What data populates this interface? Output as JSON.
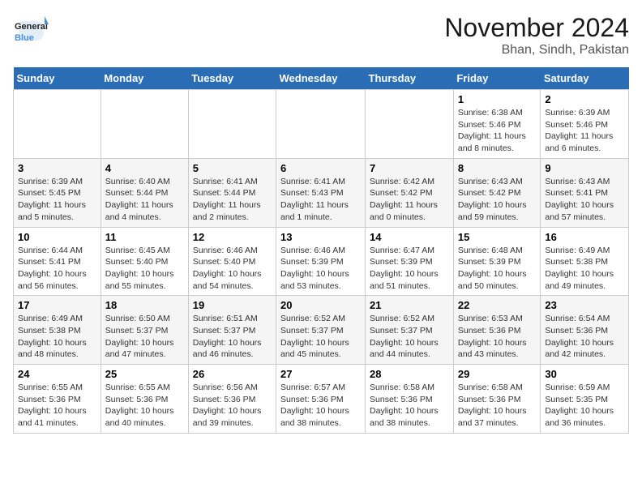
{
  "header": {
    "logo_line1": "General",
    "logo_line2": "Blue",
    "month_title": "November 2024",
    "location": "Bhan, Sindh, Pakistan"
  },
  "weekdays": [
    "Sunday",
    "Monday",
    "Tuesday",
    "Wednesday",
    "Thursday",
    "Friday",
    "Saturday"
  ],
  "weeks": [
    [
      {
        "day": "",
        "info": ""
      },
      {
        "day": "",
        "info": ""
      },
      {
        "day": "",
        "info": ""
      },
      {
        "day": "",
        "info": ""
      },
      {
        "day": "",
        "info": ""
      },
      {
        "day": "1",
        "info": "Sunrise: 6:38 AM\nSunset: 5:46 PM\nDaylight: 11 hours and 8 minutes."
      },
      {
        "day": "2",
        "info": "Sunrise: 6:39 AM\nSunset: 5:46 PM\nDaylight: 11 hours and 6 minutes."
      }
    ],
    [
      {
        "day": "3",
        "info": "Sunrise: 6:39 AM\nSunset: 5:45 PM\nDaylight: 11 hours and 5 minutes."
      },
      {
        "day": "4",
        "info": "Sunrise: 6:40 AM\nSunset: 5:44 PM\nDaylight: 11 hours and 4 minutes."
      },
      {
        "day": "5",
        "info": "Sunrise: 6:41 AM\nSunset: 5:44 PM\nDaylight: 11 hours and 2 minutes."
      },
      {
        "day": "6",
        "info": "Sunrise: 6:41 AM\nSunset: 5:43 PM\nDaylight: 11 hours and 1 minute."
      },
      {
        "day": "7",
        "info": "Sunrise: 6:42 AM\nSunset: 5:42 PM\nDaylight: 11 hours and 0 minutes."
      },
      {
        "day": "8",
        "info": "Sunrise: 6:43 AM\nSunset: 5:42 PM\nDaylight: 10 hours and 59 minutes."
      },
      {
        "day": "9",
        "info": "Sunrise: 6:43 AM\nSunset: 5:41 PM\nDaylight: 10 hours and 57 minutes."
      }
    ],
    [
      {
        "day": "10",
        "info": "Sunrise: 6:44 AM\nSunset: 5:41 PM\nDaylight: 10 hours and 56 minutes."
      },
      {
        "day": "11",
        "info": "Sunrise: 6:45 AM\nSunset: 5:40 PM\nDaylight: 10 hours and 55 minutes."
      },
      {
        "day": "12",
        "info": "Sunrise: 6:46 AM\nSunset: 5:40 PM\nDaylight: 10 hours and 54 minutes."
      },
      {
        "day": "13",
        "info": "Sunrise: 6:46 AM\nSunset: 5:39 PM\nDaylight: 10 hours and 53 minutes."
      },
      {
        "day": "14",
        "info": "Sunrise: 6:47 AM\nSunset: 5:39 PM\nDaylight: 10 hours and 51 minutes."
      },
      {
        "day": "15",
        "info": "Sunrise: 6:48 AM\nSunset: 5:39 PM\nDaylight: 10 hours and 50 minutes."
      },
      {
        "day": "16",
        "info": "Sunrise: 6:49 AM\nSunset: 5:38 PM\nDaylight: 10 hours and 49 minutes."
      }
    ],
    [
      {
        "day": "17",
        "info": "Sunrise: 6:49 AM\nSunset: 5:38 PM\nDaylight: 10 hours and 48 minutes."
      },
      {
        "day": "18",
        "info": "Sunrise: 6:50 AM\nSunset: 5:37 PM\nDaylight: 10 hours and 47 minutes."
      },
      {
        "day": "19",
        "info": "Sunrise: 6:51 AM\nSunset: 5:37 PM\nDaylight: 10 hours and 46 minutes."
      },
      {
        "day": "20",
        "info": "Sunrise: 6:52 AM\nSunset: 5:37 PM\nDaylight: 10 hours and 45 minutes."
      },
      {
        "day": "21",
        "info": "Sunrise: 6:52 AM\nSunset: 5:37 PM\nDaylight: 10 hours and 44 minutes."
      },
      {
        "day": "22",
        "info": "Sunrise: 6:53 AM\nSunset: 5:36 PM\nDaylight: 10 hours and 43 minutes."
      },
      {
        "day": "23",
        "info": "Sunrise: 6:54 AM\nSunset: 5:36 PM\nDaylight: 10 hours and 42 minutes."
      }
    ],
    [
      {
        "day": "24",
        "info": "Sunrise: 6:55 AM\nSunset: 5:36 PM\nDaylight: 10 hours and 41 minutes."
      },
      {
        "day": "25",
        "info": "Sunrise: 6:55 AM\nSunset: 5:36 PM\nDaylight: 10 hours and 40 minutes."
      },
      {
        "day": "26",
        "info": "Sunrise: 6:56 AM\nSunset: 5:36 PM\nDaylight: 10 hours and 39 minutes."
      },
      {
        "day": "27",
        "info": "Sunrise: 6:57 AM\nSunset: 5:36 PM\nDaylight: 10 hours and 38 minutes."
      },
      {
        "day": "28",
        "info": "Sunrise: 6:58 AM\nSunset: 5:36 PM\nDaylight: 10 hours and 38 minutes."
      },
      {
        "day": "29",
        "info": "Sunrise: 6:58 AM\nSunset: 5:36 PM\nDaylight: 10 hours and 37 minutes."
      },
      {
        "day": "30",
        "info": "Sunrise: 6:59 AM\nSunset: 5:35 PM\nDaylight: 10 hours and 36 minutes."
      }
    ]
  ]
}
